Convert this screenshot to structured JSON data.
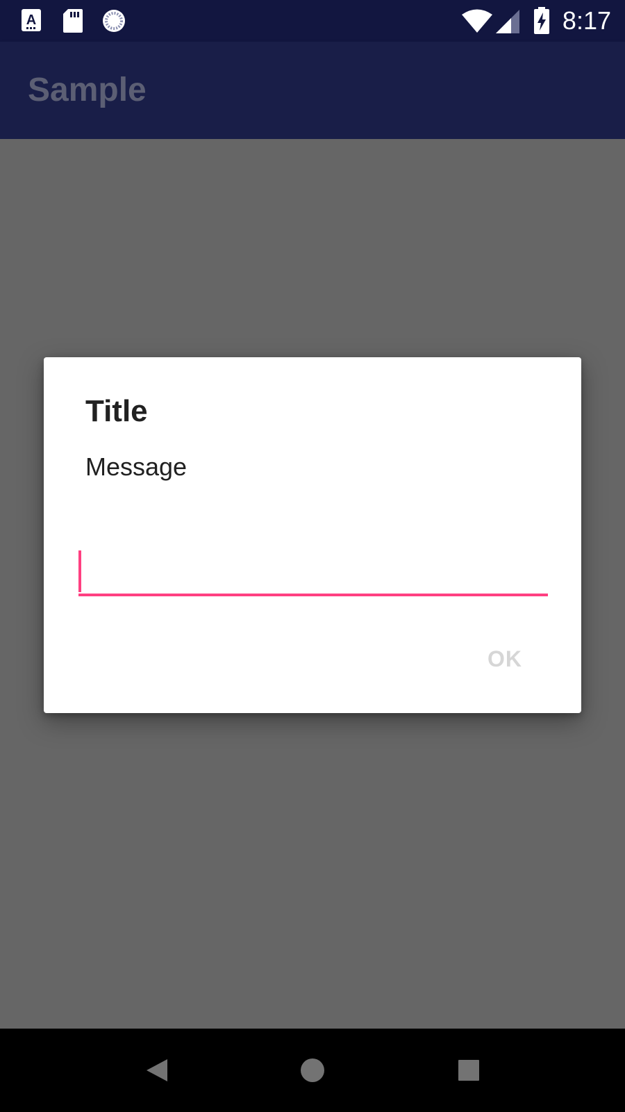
{
  "status_bar": {
    "time": "8:17",
    "icons": [
      "font-a-icon",
      "sd-card-icon",
      "sync-spinner-icon",
      "wifi-icon",
      "cell-signal-icon",
      "battery-charging-icon"
    ]
  },
  "app_bar": {
    "title": "Sample"
  },
  "dialog": {
    "title": "Title",
    "message": "Message",
    "input_value": "",
    "ok_label": "OK"
  },
  "nav_bar": {
    "icons": [
      "back-icon",
      "home-icon",
      "recents-icon"
    ]
  },
  "colors": {
    "status_bar": "#121640",
    "app_bar": "#191e48",
    "scrim": "#666666",
    "accent": "#ff4081",
    "button_disabled": "#d6d6d6"
  }
}
